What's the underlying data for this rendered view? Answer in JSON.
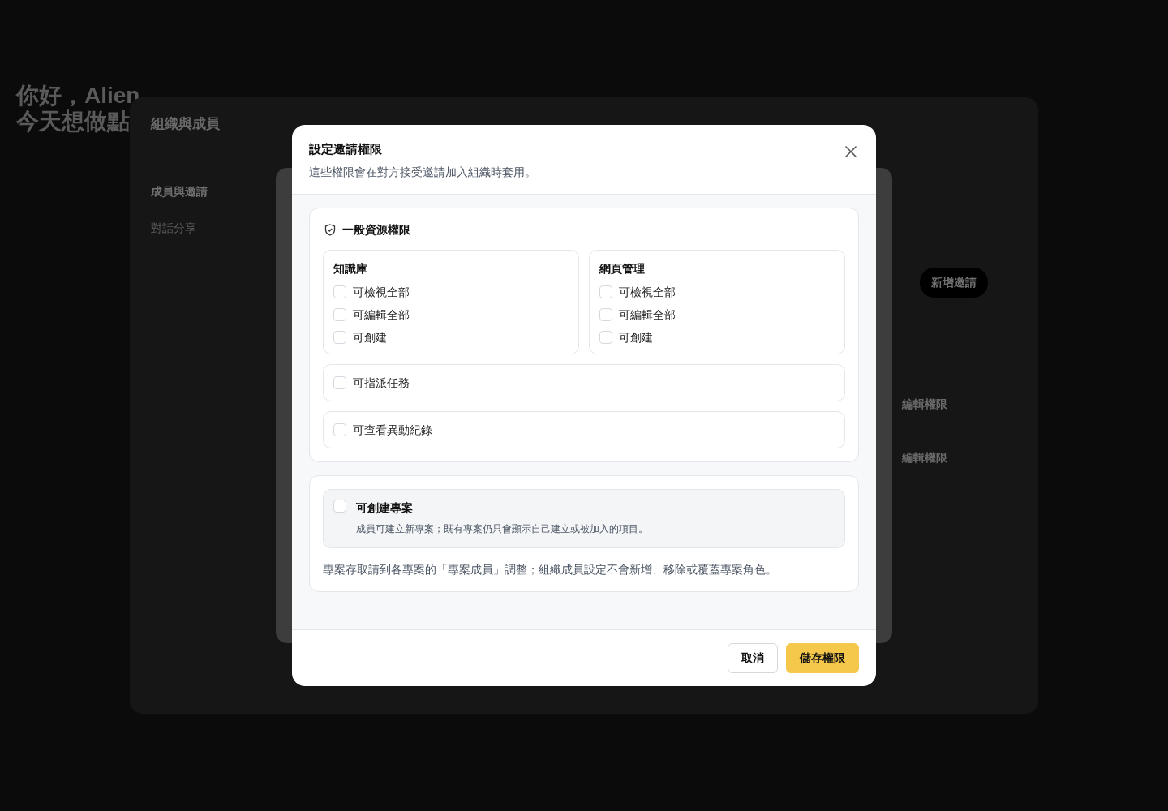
{
  "greeting": [
    "你好，Alien",
    "今天想做點"
  ],
  "org_dialog": {
    "title": "組織與成員",
    "nav": [
      {
        "label": "成員與邀請",
        "selected": true
      },
      {
        "label": "對話分享",
        "selected": false
      }
    ],
    "invite_button": "新增邀請",
    "row_actions": [
      "編輯權限",
      "編輯權限"
    ]
  },
  "dialog": {
    "title": "設定邀請權限",
    "subtitle": "這些權限會在對方接受邀請加入組織時套用。",
    "section": {
      "title": "一般資源權限",
      "groups": [
        {
          "title": "知識庫",
          "options": [
            {
              "label": "可檢視全部",
              "checked": false
            },
            {
              "label": "可編輯全部",
              "checked": false
            },
            {
              "label": "可創建",
              "checked": false
            }
          ]
        },
        {
          "title": "網頁管理",
          "options": [
            {
              "label": "可檢視全部",
              "checked": false
            },
            {
              "label": "可編輯全部",
              "checked": false
            },
            {
              "label": "可創建",
              "checked": false
            }
          ]
        }
      ],
      "options": [
        {
          "label": "可指派任務",
          "checked": false
        },
        {
          "label": "可查看異動紀錄",
          "checked": false
        }
      ]
    },
    "project": {
      "label": "可創建專案",
      "description": "成員可建立新專案；既有專案仍只會顯示自己建立或被加入的項目。",
      "checked": false
    },
    "note": "專案存取請到各專案的「專案成員」調整；組織成員設定不會新增、移除或覆蓋專案角色。",
    "buttons": [
      {
        "label": "取消",
        "kind": "secondary"
      },
      {
        "label": "儲存權限",
        "kind": "primary"
      }
    ]
  }
}
